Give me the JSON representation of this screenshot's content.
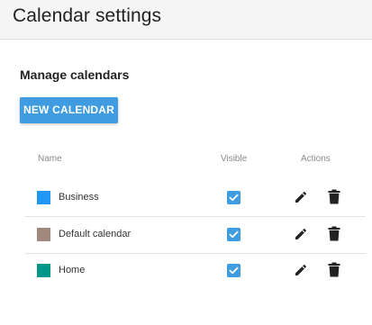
{
  "header": {
    "title": "Calendar settings"
  },
  "section": {
    "title": "Manage calendars",
    "new_button_label": "NEW CALENDAR"
  },
  "table": {
    "columns": {
      "name": "Name",
      "visible": "Visible",
      "actions": "Actions"
    },
    "rows": [
      {
        "name": "Business",
        "color": "#2196f3",
        "visible": true
      },
      {
        "name": "Default calendar",
        "color": "#a1887f",
        "visible": true
      },
      {
        "name": "Home",
        "color": "#009688",
        "visible": true
      }
    ]
  },
  "icons": {
    "edit": "edit-icon",
    "delete": "trash-icon",
    "check": "checkmark-icon"
  }
}
